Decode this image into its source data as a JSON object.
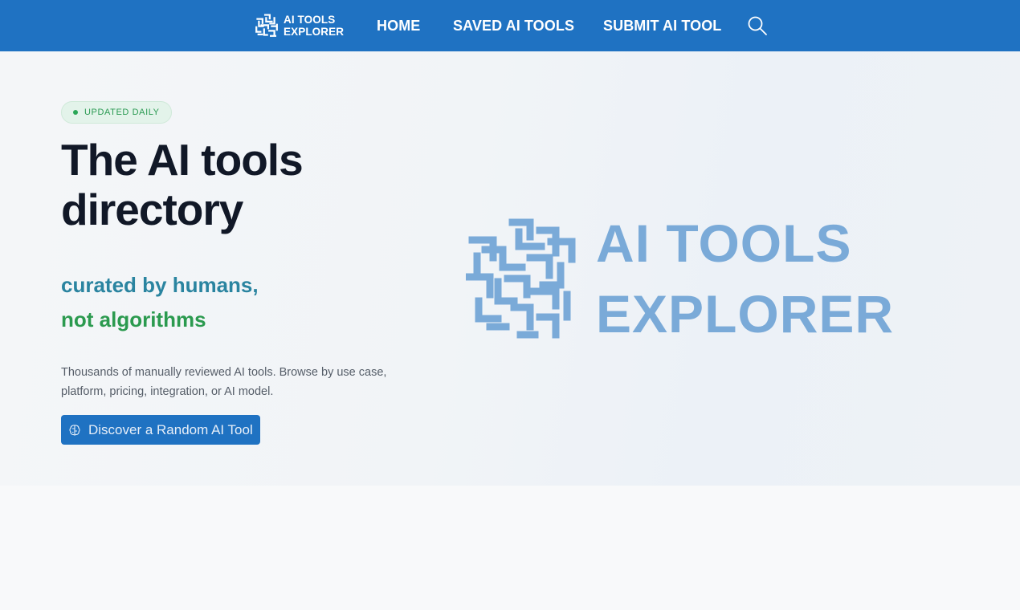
{
  "navbar": {
    "brand_line1": "AI TOOLS",
    "brand_line2": "EXPLORER",
    "links": [
      {
        "label": "HOME"
      },
      {
        "label": "SAVED AI TOOLS"
      },
      {
        "label": "SUBMIT AI TOOL"
      }
    ],
    "search_icon": "search-icon",
    "background": "#1f72c2"
  },
  "hero": {
    "badge": "UPDATED DAILY",
    "title_line1": "The AI tools",
    "title_line2": "directory",
    "tagline_line1": "curated by humans,",
    "tagline_line2": "not algorithms",
    "description": "Thousands of manually reviewed AI tools. Browse by use case, platform, pricing, integration, or AI model.",
    "cta_label": "Discover a Random AI Tool",
    "cta_icon": "brain-icon",
    "logo_line1": "AI TOOLS",
    "logo_line2": "EXPLORER"
  },
  "colors": {
    "accent": "#1f72c2",
    "tagline_teal": "#2a84a0",
    "tagline_green": "#2b9a4f",
    "badge_green": "#2aa757",
    "logo_light_blue": "#7aaad8"
  }
}
